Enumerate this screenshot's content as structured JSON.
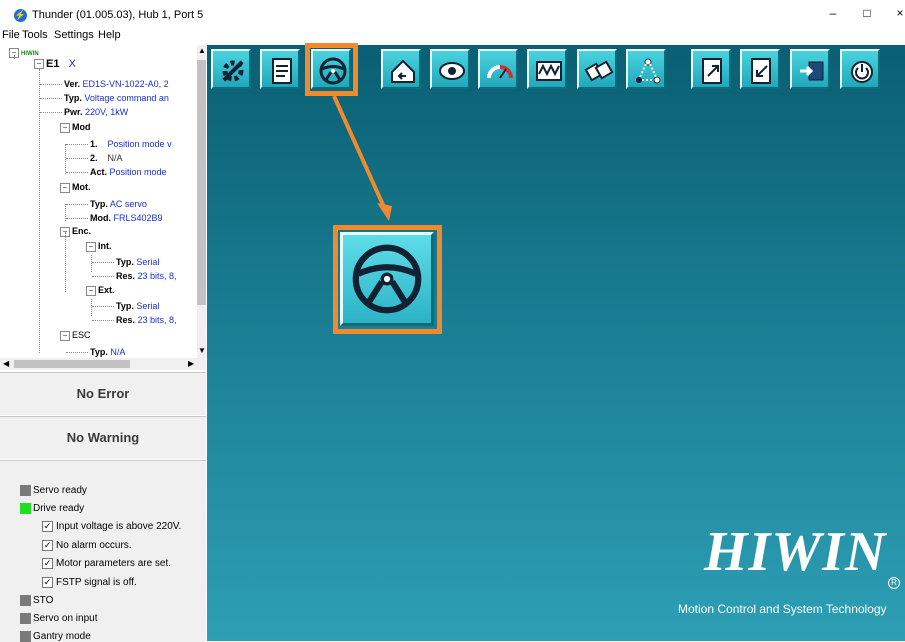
{
  "window": {
    "title": "Thunder (01.005.03), Hub 1, Port 5",
    "minimize": "–",
    "maximize": "□",
    "close": "×"
  },
  "menu": [
    "File",
    "Tools",
    "Settings",
    "Help"
  ],
  "tree": {
    "root": "HIWIN",
    "e1": {
      "label": "E1",
      "axis": "X"
    },
    "ver": {
      "key": "Ver.",
      "value": "ED1S-VN-1022-A0, 2"
    },
    "typ": {
      "key": "Typ.",
      "value": "Voltage command an"
    },
    "pwr": {
      "key": "Pwr.",
      "value": "220V, 1kW"
    },
    "mod": "Mod",
    "mod1": {
      "key": "1.",
      "value": "Position mode v"
    },
    "mod2": {
      "key": "2.",
      "value": "N/A"
    },
    "modact": {
      "key": "Act.",
      "value": "Position mode"
    },
    "mot": "Mot.",
    "mottyp": {
      "key": "Typ.",
      "value": "AC servo"
    },
    "motmod": {
      "key": "Mod.",
      "value": "FRLS402B9"
    },
    "enc": "Enc.",
    "int": "Int.",
    "inttyp": {
      "key": "Typ.",
      "value": "Serial"
    },
    "intres": {
      "key": "Res.",
      "value": "23 bits, 8,"
    },
    "ext": "Ext.",
    "exttyp": {
      "key": "Typ.",
      "value": "Serial"
    },
    "extres": {
      "key": "Res.",
      "value": "23 bits, 8,"
    },
    "esc": "ESC",
    "esctyp": {
      "key": "Typ.",
      "value": "N/A"
    }
  },
  "status": {
    "error": "No Error",
    "warning": "No Warning"
  },
  "conditions": {
    "servo_ready": "Servo ready",
    "drive_ready": "Drive ready",
    "input_voltage": "Input voltage is above 220V.",
    "no_alarm": "No alarm occurs.",
    "motor_params": "Motor parameters are set.",
    "fstp": "FSTP signal is off.",
    "sto": "STO",
    "servo_on_input": "Servo on input",
    "gantry_mode": "Gantry mode"
  },
  "colors": {
    "indicator_off": "#7a7a7a",
    "indicator_on": "#22dd22",
    "highlight": "#f08a2c",
    "tree_value": "#1a2fcf"
  },
  "toolbar_icons": [
    "configuration-icon",
    "parameters-icon",
    "steering-wheel-icon",
    "home-icon",
    "scope-eye-icon",
    "performance-gauge-icon",
    "waveform-icon",
    "io-connector-icon",
    "motion-path-icon",
    "upload-icon",
    "download-icon",
    "firmware-icon",
    "power-reset-icon"
  ],
  "brand": {
    "logo": "HIWIN",
    "tagline": "Motion Control and System Technology"
  }
}
